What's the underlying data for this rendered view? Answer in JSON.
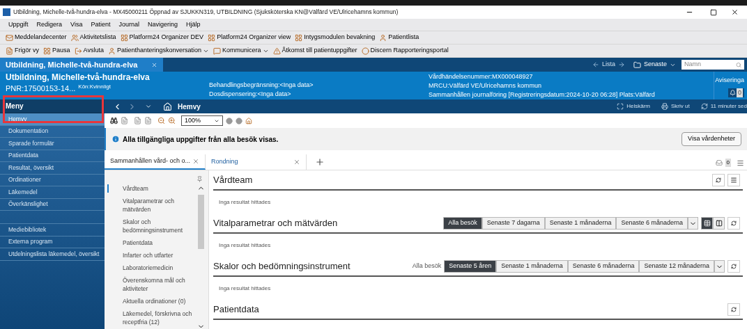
{
  "window": {
    "title": "Utbildning, Michelle-två-hundra-elva - MX45000211 Öppnad av SJUKKN319, UTBILDNING (Sjuksköterska KN@Välfärd VE/Ulricehamns kommun)"
  },
  "menu_bar": [
    "Uppgift",
    "Redigera",
    "Visa",
    "Patient",
    "Journal",
    "Navigering",
    "Hjälp"
  ],
  "toolbars": [
    [
      {
        "label": "Meddelandecenter",
        "dropdown": false
      },
      {
        "label": "Aktivitetslista",
        "dropdown": false
      },
      {
        "label": "Platform24 Organizer DEV",
        "dropdown": false
      },
      {
        "label": "Platform24 Organizer view",
        "dropdown": false
      },
      {
        "label": "Intygsmodulen bevakning",
        "dropdown": false
      },
      {
        "label": "Patientlista",
        "dropdown": false
      }
    ],
    [
      {
        "label": "Frigör vy",
        "dropdown": false
      },
      {
        "label": "Pausa",
        "dropdown": false
      },
      {
        "label": "Avsluta",
        "dropdown": false
      },
      {
        "label": "Patienthanteringskonversation",
        "dropdown": true
      },
      {
        "label": "Kommunicera",
        "dropdown": true
      },
      {
        "label": "Åtkomst till patientuppgifter",
        "dropdown": false
      },
      {
        "label": "Discern Rapporteringsportal",
        "dropdown": false
      }
    ]
  ],
  "patient_tab": {
    "label": "Utbildning, Michelle-två-hundra-elva"
  },
  "top_nav": {
    "list_label": "Lista",
    "recent_label": "Senaste",
    "search_placeholder": "Namn"
  },
  "patient_header": {
    "name": "Utbildning, Michelle-två-hundra-elva",
    "pnr": "PNR:17500153-14...",
    "gender": "Kön:Kvinnligt",
    "column_2": [
      "Behandlingsbegränsning:<Inga data>",
      "Dosdispensering:<Inga data>"
    ],
    "column_3": [
      "Vårdhändelsenummer:MX000048927",
      "MRCU:Välfärd VE/Ulricehamns kommun",
      "Sammanhållen journalföring [Registreringsdatum:2024-10-20 06:28] Plats:Välfärd"
    ],
    "notifications_label": "Aviseringa",
    "notifications_count": "0"
  },
  "nav_bar": {
    "menu_title": "Meny",
    "page_title": "Hemvy",
    "actions": [
      {
        "kind": "fullscreen",
        "label": "Helskärm"
      },
      {
        "kind": "print",
        "label": "Skriv ut"
      },
      {
        "kind": "refresh",
        "label": "11 minuter sed"
      }
    ]
  },
  "sidebar": {
    "groups": [
      [
        {
          "label": "Hemvy",
          "selected": true
        },
        {
          "label": "Dokumentation",
          "selected": false
        },
        {
          "label": "Sparade formulär",
          "selected": false
        },
        {
          "label": "Patientdata",
          "selected": false
        },
        {
          "label": "Resultat, översikt",
          "selected": false
        },
        {
          "label": "Ordinationer",
          "selected": false
        },
        {
          "label": "Läkemedel",
          "selected": false
        },
        {
          "label": "Överkänslighet",
          "selected": false
        }
      ],
      [
        {
          "label": "Mediebibliotek",
          "selected": false
        },
        {
          "label": "Externa program",
          "selected": false
        },
        {
          "label": "Utdelningslista läkemedel, översikt",
          "selected": false
        }
      ]
    ]
  },
  "page_toolbar": {
    "zoom": "100%"
  },
  "banner": {
    "text": "Alla tillgängliga uppgifter från alla besök visas.",
    "button": "Visa vårdenheter"
  },
  "content_tabs": [
    {
      "label": "Sammanhållen vård- och o...",
      "selected": true
    },
    {
      "label": "Rondning",
      "selected": false
    }
  ],
  "inbox_count": "0",
  "index": [
    {
      "label": "Vårdteam",
      "selected": true
    },
    {
      "label": "Vitalparametrar och mätvärden",
      "selected": false
    },
    {
      "label": "Skalor och bedömningsinstrument",
      "selected": false
    },
    {
      "label": "Patientdata",
      "selected": false
    },
    {
      "label": "Infarter och utfarter",
      "selected": false
    },
    {
      "label": "Laboratoriemedicin",
      "selected": false
    },
    {
      "label": "Överenskomna mål och aktiviteter",
      "selected": false
    },
    {
      "label": "Aktuella ordinationer (0)",
      "selected": false
    },
    {
      "label": "Läkemedel, förskrivna och receptfria (12)",
      "selected": false
    }
  ],
  "sections": [
    {
      "title": "Vårdteam",
      "menu": true,
      "empty_text": "Inga resultat hittades"
    },
    {
      "title": "Vitalparametrar och mätvärden",
      "menu": false,
      "filter_options": [
        {
          "label": "Alla besök",
          "selected": true
        },
        {
          "label": "Senaste 7 dagarna",
          "selected": false
        },
        {
          "label": "Senaste 1 månaderna",
          "selected": false
        },
        {
          "label": "Senaste 6 månaderna",
          "selected": false
        }
      ],
      "view_toggle": {
        "table_selected": true
      },
      "empty_text": "Inga resultat hittades"
    },
    {
      "title": "Skalor och bedömningsinstrument",
      "menu": false,
      "filter_label": "Alla besök",
      "filter_options": [
        {
          "label": "Senaste 5 åren",
          "selected": true
        },
        {
          "label": "Senaste 1 månaderna",
          "selected": false
        },
        {
          "label": "Senaste 6 månaderna",
          "selected": false
        },
        {
          "label": "Senaste 12 månaderna",
          "selected": false
        }
      ],
      "empty_text": "Inga resultat hittades"
    },
    {
      "title": "Patientdata",
      "menu": false
    }
  ]
}
